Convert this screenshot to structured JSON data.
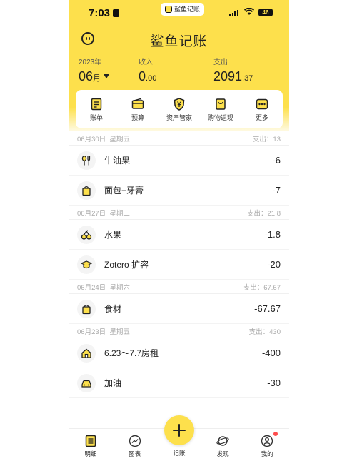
{
  "status": {
    "time": "7:03",
    "app_pill": "鲨鱼记账",
    "battery": "46"
  },
  "header": {
    "title": "鲨鱼记账"
  },
  "summary": {
    "year_label": "2023年",
    "month": "06",
    "month_suffix": "月",
    "income_label": "收入",
    "income_int": "0",
    "income_dec": ".00",
    "expense_label": "支出",
    "expense_int": "2091",
    "expense_dec": ".37"
  },
  "quick_actions": [
    {
      "label": "账单",
      "icon": "bill-icon"
    },
    {
      "label": "预算",
      "icon": "wallet-icon"
    },
    {
      "label": "资产管家",
      "icon": "shield-yen-icon"
    },
    {
      "label": "购物返现",
      "icon": "shopping-icon"
    },
    {
      "label": "更多",
      "icon": "more-icon"
    }
  ],
  "days": [
    {
      "date": "06月30日",
      "weekday": "星期五",
      "total": "支出：13",
      "items": [
        {
          "name": "牛油果",
          "amount": "-6",
          "icon": "dining-icon"
        },
        {
          "name": "面包+牙膏",
          "amount": "-7",
          "icon": "shopping-bag-icon"
        }
      ]
    },
    {
      "date": "06月27日",
      "weekday": "星期二",
      "total": "支出：21.8",
      "items": [
        {
          "name": "水果",
          "amount": "-1.8",
          "icon": "fruit-icon"
        },
        {
          "name": "Zotero 扩容",
          "amount": "-20",
          "icon": "graduation-cap-icon"
        }
      ]
    },
    {
      "date": "06月24日",
      "weekday": "星期六",
      "total": "支出：67.67",
      "items": [
        {
          "name": "食材",
          "amount": "-67.67",
          "icon": "shopping-bag-icon"
        }
      ]
    },
    {
      "date": "06月23日",
      "weekday": "星期五",
      "total": "支出：430",
      "items": [
        {
          "name": "6.23～7.7房租",
          "amount": "-400",
          "icon": "house-icon"
        },
        {
          "name": "加油",
          "amount": "-30",
          "icon": "car-icon"
        }
      ]
    }
  ],
  "tabs": [
    {
      "label": "明细",
      "icon": "list-icon"
    },
    {
      "label": "图表",
      "icon": "chart-icon"
    },
    {
      "label": "记账",
      "icon": "add-icon"
    },
    {
      "label": "发现",
      "icon": "planet-icon"
    },
    {
      "label": "我的",
      "icon": "profile-icon"
    }
  ],
  "colors": {
    "accent": "#fde04c",
    "text": "#222222",
    "muted": "#aaaaaa",
    "badge": "#ff4d4d"
  }
}
